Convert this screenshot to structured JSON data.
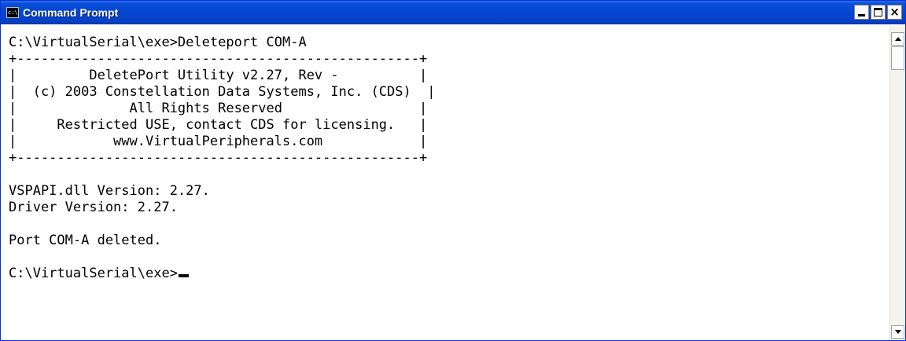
{
  "window": {
    "title": "Command Prompt",
    "icon": "console-icon",
    "controls": {
      "minimize": "minimize-icon",
      "maximize": "maximize-icon",
      "close": "×"
    }
  },
  "console": {
    "lines": [
      "C:\\VirtualSerial\\exe>Deleteport COM-A",
      "+--------------------------------------------------+",
      "|         DeletePort Utility v2.27, Rev -          |",
      "|  (c) 2003 Constellation Data Systems, Inc. (CDS)  |",
      "|              All Rights Reserved                 |",
      "|     Restricted USE, contact CDS for licensing.   |",
      "|            www.VirtualPeripherals.com            |",
      "+--------------------------------------------------+",
      "VSPAPI.dll Version: 2.27.",
      "Driver Version: 2.27.",
      "Port COM-A deleted.",
      "C:\\VirtualSerial\\exe>"
    ]
  },
  "colors": {
    "titlebar": "#0346d0",
    "text": "#000000",
    "background": "#ffffff"
  }
}
